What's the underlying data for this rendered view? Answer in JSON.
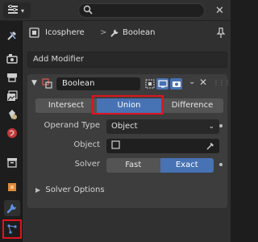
{
  "header": {
    "search_placeholder": "",
    "close_glyph": "✕"
  },
  "tabs": [
    {
      "icon": "tool-icon"
    },
    {
      "icon": "render-icon"
    },
    {
      "icon": "output-icon"
    },
    {
      "icon": "view-layer-icon"
    },
    {
      "icon": "scene-icon"
    },
    {
      "icon": "world-icon"
    },
    {
      "icon": "collection-icon"
    },
    {
      "icon": "object-icon"
    },
    {
      "icon": "modifier-wrench-icon",
      "active": true
    },
    {
      "icon": "particles-icon"
    }
  ],
  "breadcrumb": {
    "object_name": "Icosphere",
    "separator": ">",
    "modifier_name": "Boolean"
  },
  "add_modifier_label": "Add Modifier",
  "modifier": {
    "name": "Boolean",
    "operations": [
      "Intersect",
      "Union",
      "Difference"
    ],
    "active_operation": "Union",
    "operand_type_label": "Operand Type",
    "operand_type_value": "Object",
    "object_label": "Object",
    "object_value": "",
    "solver_label": "Solver",
    "solver_options": [
      "Fast",
      "Exact"
    ],
    "active_solver": "Exact",
    "solver_options_panel": "Solver Options"
  },
  "colors": {
    "accent": "#4772b3",
    "highlight_box": "#e0141e",
    "panel_bg": "#303030",
    "modifier_bg": "#3d3d3d"
  }
}
